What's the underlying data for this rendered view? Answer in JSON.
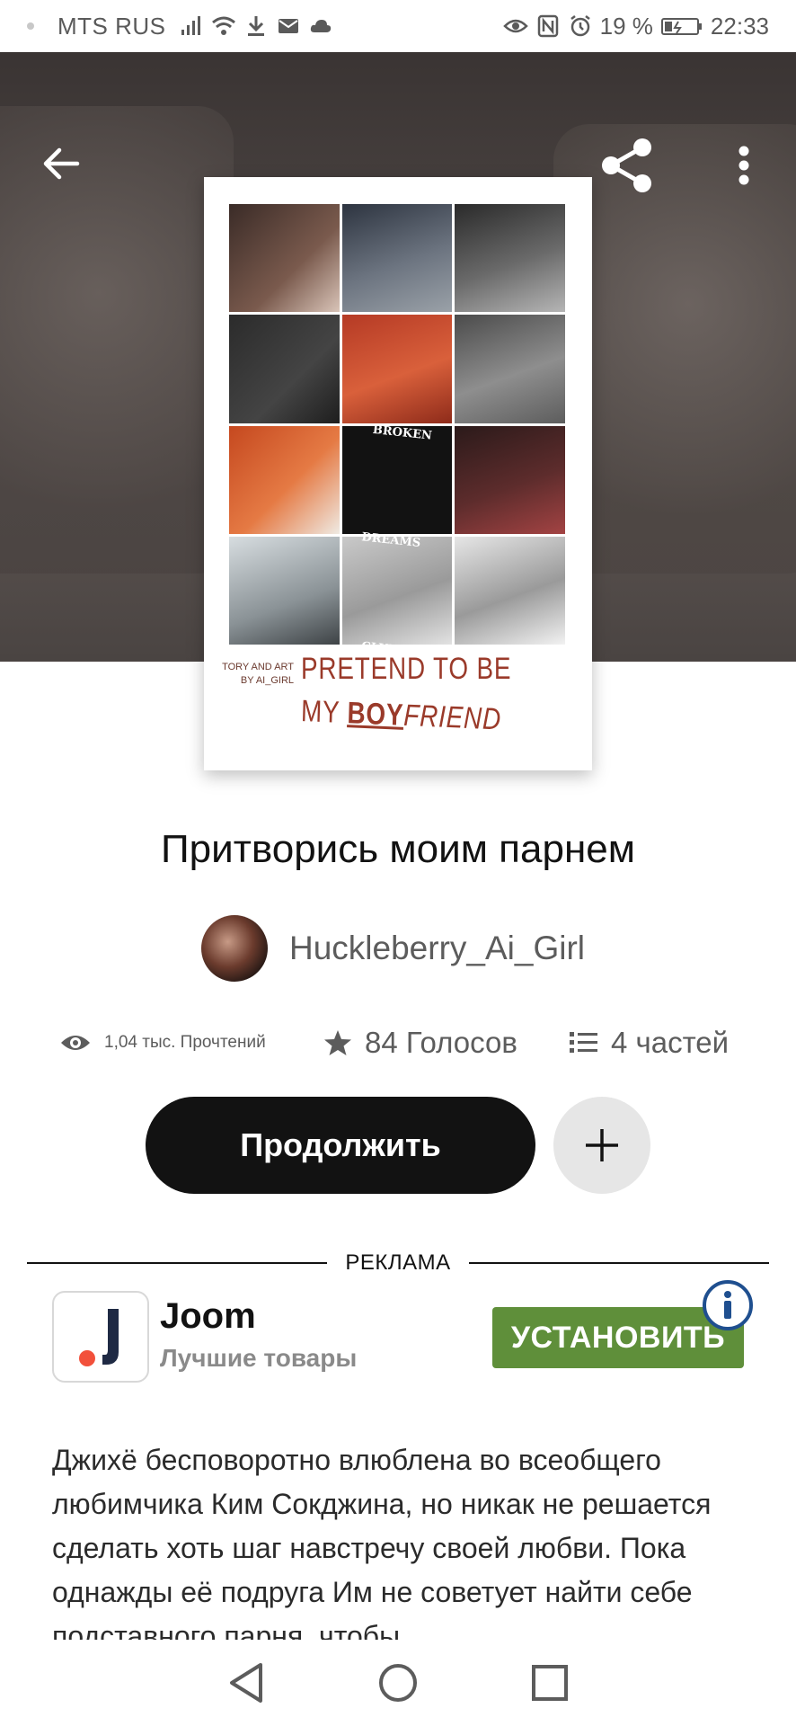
{
  "status_bar": {
    "carrier": "MTS RUS",
    "battery": "19 %",
    "time": "22:33",
    "icons": [
      "signal-icon",
      "wifi-icon",
      "download-icon",
      "mail-icon",
      "cloud-icon",
      "eye-icon",
      "nfc-icon",
      "alarm-icon",
      "battery-icon"
    ]
  },
  "header": {
    "icons": [
      "back-arrow-icon",
      "share-icon",
      "more-vert-icon"
    ]
  },
  "cover": {
    "credit_line1": "TORY AND ART",
    "credit_line2": "BY AI_GIRL",
    "title_line1": "PRETEND TO BE",
    "title_line2_a": "MY",
    "title_line2_b": "BOY",
    "title_line2_c": "FRIEND",
    "club_line1": "BROKEN",
    "club_line2": "DREAMS",
    "club_line3": "CLUB"
  },
  "story": {
    "title": "Притворись моим парнем",
    "author": "Huckleberry_Ai_Girl"
  },
  "stats": {
    "reads": "1,04 тыс. Прочтений",
    "votes": "84 Голосов",
    "parts": "4 частей"
  },
  "actions": {
    "continue_label": "Продолжить",
    "add_label": "+"
  },
  "ad": {
    "section_label": "РЕКЛАМА",
    "app_name": "Joom",
    "tagline": "Лучшие товары",
    "install_label": "УСТАНОВИТЬ",
    "info_label": "i"
  },
  "description": {
    "text": "Джихё бесповоротно влюблена во всеобщего любимчика Ким Сокджина, но никак не решается сделать хоть шаг навстречу своей любви. Пока однажды её подруга Им не советует найти себе подставного парня, чтобы"
  },
  "colors": {
    "continue_bg": "#121212",
    "install_bg": "#5f8f3a",
    "info_ring": "#1f4f8f",
    "joom_red": "#f2503b",
    "joom_navy": "#1f2a44"
  }
}
